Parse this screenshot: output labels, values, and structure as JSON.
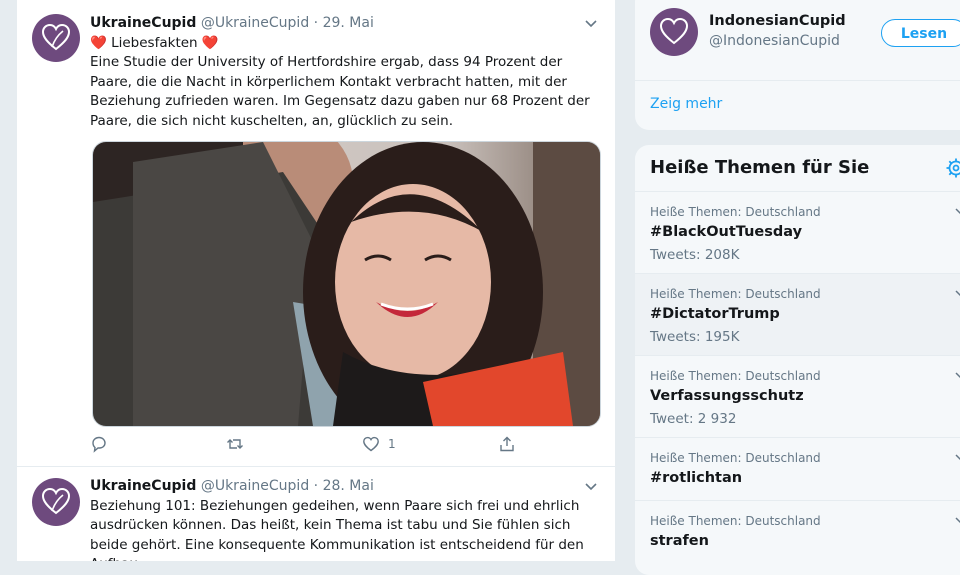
{
  "tweets": [
    {
      "name": "UkraineCupid",
      "handle": "@UkraineCupid",
      "separator": "·",
      "date": "29. Mai",
      "title_line": "Liebesfakten",
      "heart": "❤️",
      "text": "Eine Studie der University of Hertfordshire ergab, dass 94 Prozent der Paare, die die Nacht in körperlichem Kontakt verbracht hatten, mit der Beziehung zufrieden waren. Im Gegensatz dazu gaben nur 68 Prozent der Paare, die sich nicht kuschelten, an, glücklich zu sein.",
      "likes": "1"
    },
    {
      "name": "UkraineCupid",
      "handle": "@UkraineCupid",
      "separator": "·",
      "date": "28. Mai",
      "text": "Beziehung 101: Beziehungen gedeihen, wenn Paare sich frei und ehrlich ausdrücken können. Das heißt, kein Thema ist tabu und Sie fühlen sich beide gehört. Eine konsequente Kommunikation ist entscheidend für den Aufbau"
    }
  ],
  "who_to_follow": {
    "name": "IndonesianCupid",
    "handle": "@IndonesianCupid",
    "follow_label": "Lesen",
    "show_more": "Zeig mehr"
  },
  "trends": {
    "title": "Heiße Themen für Sie",
    "items": [
      {
        "context": "Heiße Themen: Deutschland",
        "name": "#BlackOutTuesday",
        "count": "Tweets: 208K"
      },
      {
        "context": "Heiße Themen: Deutschland",
        "name": "#DictatorTrump",
        "count": "Tweets: 195K"
      },
      {
        "context": "Heiße Themen: Deutschland",
        "name": "Verfassungsschutz",
        "count": "Tweet: 2 932"
      },
      {
        "context": "Heiße Themen: Deutschland",
        "name": "#rotlichtan",
        "count": ""
      },
      {
        "context": "Heiße Themen: Deutschland",
        "name": "strafen",
        "count": ""
      }
    ]
  },
  "colors": {
    "accent": "#1da1f2",
    "avatar_bg": "#6e4a7e",
    "heart": "#e0245e"
  },
  "icons": [
    "heart-logo-icon",
    "chevron-down-icon",
    "reply-icon",
    "retweet-icon",
    "like-icon",
    "share-icon",
    "gear-icon",
    "red-heart-emoji"
  ]
}
